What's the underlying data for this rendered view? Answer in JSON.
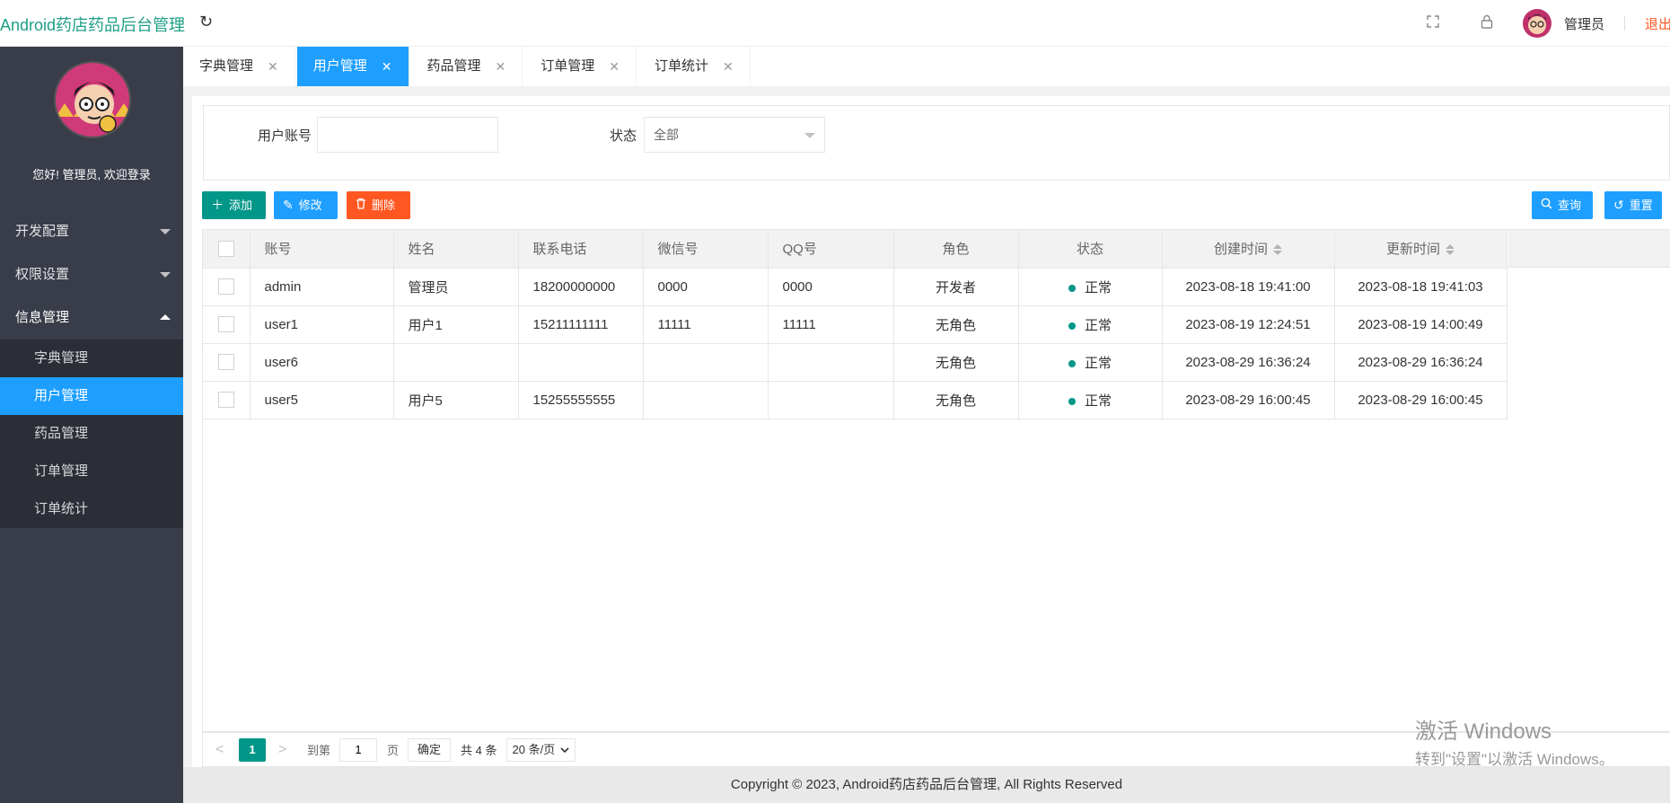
{
  "header": {
    "logo": "Android药店药品后台管理",
    "refresh_icon": "refresh-icon",
    "fullscreen_icon": "fullscreen-icon",
    "lock_icon": "lock-icon",
    "user": "管理员",
    "logout": "退出"
  },
  "sidebar": {
    "greeting": "您好! 管理员, 欢迎登录",
    "groups": [
      {
        "label": "开发配置"
      },
      {
        "label": "权限设置"
      },
      {
        "label": "信息管理"
      }
    ],
    "items": [
      {
        "label": "字典管理"
      },
      {
        "label": "用户管理"
      },
      {
        "label": "药品管理"
      },
      {
        "label": "订单管理"
      },
      {
        "label": "订单统计"
      }
    ]
  },
  "tabs": [
    {
      "label": "字典管理",
      "close": "✕"
    },
    {
      "label": "用户管理",
      "close": "✕"
    },
    {
      "label": "药品管理",
      "close": "✕"
    },
    {
      "label": "订单管理",
      "close": "✕"
    },
    {
      "label": "订单统计",
      "close": "✕"
    }
  ],
  "filter": {
    "account_label": "用户账号",
    "account_value": "",
    "status_label": "状态",
    "status_value": "全部"
  },
  "toolbar": {
    "add": "添加",
    "edit": "修改",
    "delete": "删除",
    "search": "查询",
    "reset": "重置"
  },
  "table": {
    "headers": [
      "账号",
      "姓名",
      "联系电话",
      "微信号",
      "QQ号",
      "角色",
      "状态",
      "创建时间",
      "更新时间"
    ],
    "rows": [
      [
        "admin",
        "管理员",
        "18200000000",
        "0000",
        "0000",
        "开发者",
        "正常",
        "2023-08-18 19:41:00",
        "2023-08-18 19:41:03"
      ],
      [
        "user1",
        "用户1",
        "15211111111",
        "11111",
        "11111",
        "无角色",
        "正常",
        "2023-08-19 12:24:51",
        "2023-08-19 14:00:49"
      ],
      [
        "user6",
        "",
        "",
        "",
        "",
        "无角色",
        "正常",
        "2023-08-29 16:36:24",
        "2023-08-29 16:36:24"
      ],
      [
        "user5",
        "用户5",
        "15255555555",
        "",
        "",
        "无角色",
        "正常",
        "2023-08-29 16:00:45",
        "2023-08-29 16:00:45"
      ]
    ]
  },
  "pager": {
    "prev": "<",
    "current": "1",
    "next": ">",
    "goto_label": "到第",
    "goto_value": "1",
    "page_label": "页",
    "ok": "确定",
    "total": "共 4 条",
    "size": "20 条/页"
  },
  "watermark": {
    "line1": "激活 Windows",
    "line2": "转到\"设置\"以激活 Windows。"
  },
  "footer": "Copyright © 2023, Android药店药品后台管理, All Rights Reserved",
  "colors": {
    "primary": "#1e9fff",
    "green": "#009688",
    "danger": "#ff5722",
    "sidebar": "#393d49"
  }
}
